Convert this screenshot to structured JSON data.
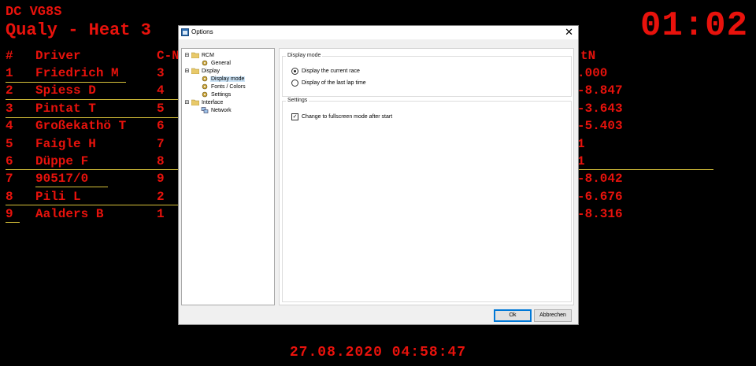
{
  "background": {
    "series": "DC VG8S",
    "heat": "Qualy - Heat 3",
    "clock": "01:02",
    "footer_datetime": "27.08.2020 04:58:47",
    "columns": {
      "rank": "#",
      "driver": "Driver",
      "car": "C-N",
      "right": "tN"
    },
    "rows": [
      {
        "rank": "1",
        "driver": "Friedrich M",
        "car": "3",
        "right": ".000"
      },
      {
        "rank": "2",
        "driver": "Spiess D",
        "car": "4",
        "right": "-8.847"
      },
      {
        "rank": "3",
        "driver": "Pintat T",
        "car": "5",
        "right": "-3.643"
      },
      {
        "rank": "4",
        "driver": "Großekathö T",
        "car": "6",
        "right": "-5.403"
      },
      {
        "rank": "5",
        "driver": "Faigle H",
        "car": "7",
        "right": "1"
      },
      {
        "rank": "6",
        "driver": "Düppe F",
        "car": "8",
        "right": "1"
      },
      {
        "rank": "7",
        "driver": "90517/0",
        "car": "9",
        "right": "-8.042"
      },
      {
        "rank": "8",
        "driver": "Pili L",
        "car": "2",
        "right": "-6.676"
      },
      {
        "rank": "9",
        "driver": "Aalders B",
        "car": "1",
        "right": "-8.316"
      }
    ]
  },
  "dialog": {
    "title": "Options",
    "close_glyph": "✕",
    "tree": [
      {
        "label": "RCM",
        "level": 0,
        "expanded": true
      },
      {
        "label": "General",
        "level": 1
      },
      {
        "label": "Display",
        "level": 0,
        "expanded": true
      },
      {
        "label": "Display mode",
        "level": 1,
        "selected": true
      },
      {
        "label": "Fonts / Colors",
        "level": 1
      },
      {
        "label": "Settings",
        "level": 1
      },
      {
        "label": "Interface",
        "level": 0,
        "expanded": true
      },
      {
        "label": "Network",
        "level": 1
      }
    ],
    "display_mode_group": "Display mode",
    "radio_current": "Display the current race",
    "radio_lastlap": "Display of the last lap time",
    "settings_group": "Settings",
    "checkbox_fullscreen": "Change to fullscreen mode after start",
    "ok_label": "Ok",
    "cancel_label": "Abbrechen"
  },
  "colors": {
    "text_red": "#e8120c",
    "underline": "#d8c23a",
    "bg": "#000000"
  }
}
